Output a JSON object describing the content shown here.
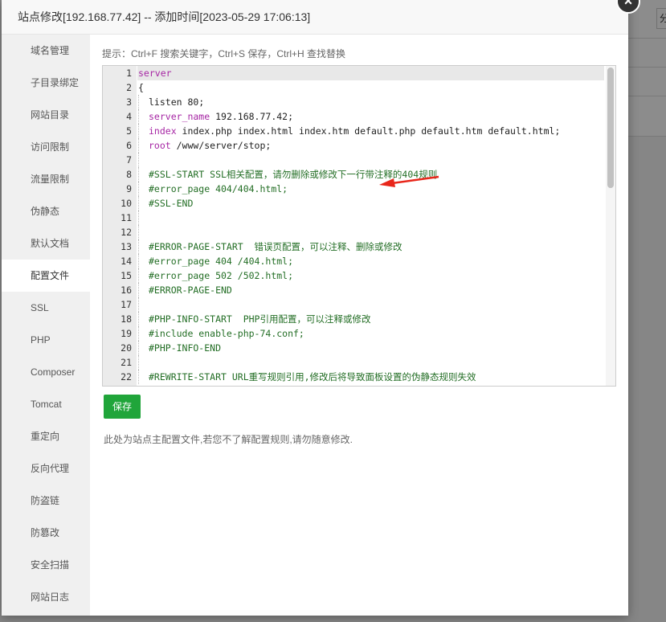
{
  "modal": {
    "title": "站点修改[192.168.77.42] -- 添加时间[2023-05-29 17:06:13]",
    "close_label": "×"
  },
  "background": {
    "button_label": "分"
  },
  "sidebar": {
    "items": [
      {
        "label": "域名管理"
      },
      {
        "label": "子目录绑定"
      },
      {
        "label": "网站目录"
      },
      {
        "label": "访问限制"
      },
      {
        "label": "流量限制"
      },
      {
        "label": "伪静态"
      },
      {
        "label": "默认文档"
      },
      {
        "label": "配置文件",
        "active": true
      },
      {
        "label": "SSL"
      },
      {
        "label": "PHP"
      },
      {
        "label": "Composer"
      },
      {
        "label": "Tomcat"
      },
      {
        "label": "重定向"
      },
      {
        "label": "反向代理"
      },
      {
        "label": "防盗链"
      },
      {
        "label": "防篡改"
      },
      {
        "label": "安全扫描"
      },
      {
        "label": "网站日志"
      }
    ]
  },
  "content": {
    "tip": "提示：Ctrl+F 搜索关键字，Ctrl+S 保存，Ctrl+H 查找替换",
    "save_label": "保存",
    "note": "此处为站点主配置文件,若您不了解配置规则,请勿随意修改."
  },
  "editor": {
    "lines": [
      {
        "n": "1",
        "indent": 0,
        "parts": [
          [
            "kw-purple",
            "server"
          ]
        ]
      },
      {
        "n": "2",
        "indent": 0,
        "parts": [
          [
            "",
            "{"
          ]
        ]
      },
      {
        "n": "3",
        "indent": 1,
        "parts": [
          [
            "",
            "listen 80;"
          ]
        ]
      },
      {
        "n": "4",
        "indent": 1,
        "parts": [
          [
            "kw-purple",
            "server_name"
          ],
          [
            "",
            " 192.168.77.42;"
          ]
        ]
      },
      {
        "n": "5",
        "indent": 1,
        "parts": [
          [
            "kw-purple",
            "index"
          ],
          [
            "",
            " index.php index.html index.htm default.php default.htm default.html;"
          ]
        ]
      },
      {
        "n": "6",
        "indent": 1,
        "parts": [
          [
            "kw-purple",
            "root"
          ],
          [
            "",
            " /www/server/stop;"
          ]
        ]
      },
      {
        "n": "7",
        "indent": 1,
        "parts": []
      },
      {
        "n": "8",
        "indent": 1,
        "parts": [
          [
            "cm",
            "#SSL-START SSL相关配置，请勿删除或修改下一行带注释的404规则"
          ]
        ]
      },
      {
        "n": "9",
        "indent": 1,
        "parts": [
          [
            "cm",
            "#error_page 404/404.html;"
          ]
        ]
      },
      {
        "n": "10",
        "indent": 1,
        "parts": [
          [
            "cm",
            "#SSL-END"
          ]
        ]
      },
      {
        "n": "11",
        "indent": 1,
        "parts": []
      },
      {
        "n": "12",
        "indent": 1,
        "parts": []
      },
      {
        "n": "13",
        "indent": 1,
        "parts": [
          [
            "cm",
            "#ERROR-PAGE-START  错误页配置，可以注释、删除或修改"
          ]
        ]
      },
      {
        "n": "14",
        "indent": 1,
        "parts": [
          [
            "cm",
            "#error_page 404 /404.html;"
          ]
        ]
      },
      {
        "n": "15",
        "indent": 1,
        "parts": [
          [
            "cm",
            "#error_page 502 /502.html;"
          ]
        ]
      },
      {
        "n": "16",
        "indent": 1,
        "parts": [
          [
            "cm",
            "#ERROR-PAGE-END"
          ]
        ]
      },
      {
        "n": "17",
        "indent": 1,
        "parts": []
      },
      {
        "n": "18",
        "indent": 1,
        "parts": [
          [
            "cm",
            "#PHP-INFO-START  PHP引用配置，可以注释或修改"
          ]
        ]
      },
      {
        "n": "19",
        "indent": 1,
        "parts": [
          [
            "cm",
            "#include enable-php-74.conf;"
          ]
        ]
      },
      {
        "n": "20",
        "indent": 1,
        "parts": [
          [
            "cm",
            "#PHP-INFO-END"
          ]
        ]
      },
      {
        "n": "21",
        "indent": 1,
        "parts": []
      },
      {
        "n": "22",
        "indent": 1,
        "parts": [
          [
            "cm",
            "#REWRITE-START URL重写规则引用,修改后将导致面板设置的伪静态规则失效"
          ]
        ]
      }
    ]
  },
  "colors": {
    "accent_green": "#20a53a",
    "annotation_arrow": "#e8261a"
  }
}
